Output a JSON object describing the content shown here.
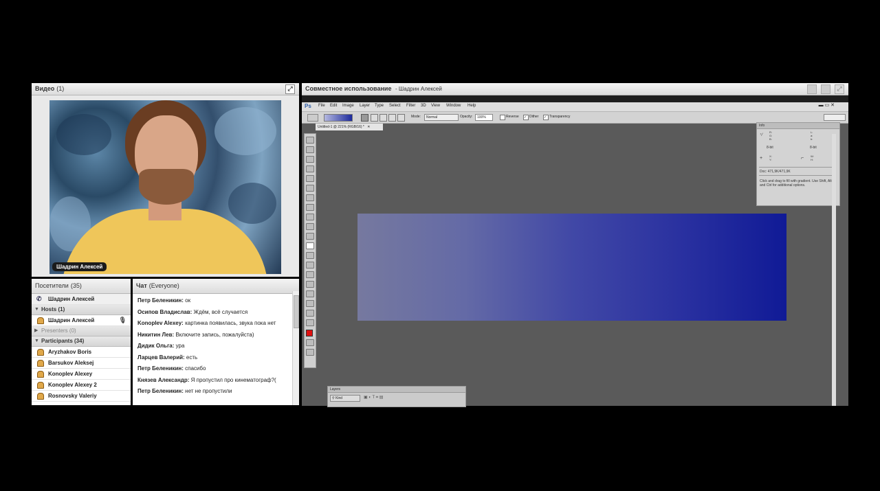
{
  "video": {
    "title": "Видео",
    "count": "(1)",
    "speaker": "Шадрин Алексей"
  },
  "attendees": {
    "title": "Посетители",
    "count": "(35)",
    "current_user": "Шадрин Алексей",
    "hosts_label": "Hosts (1)",
    "hosts": [
      "Шадрин Алексей"
    ],
    "presenters_label": "Presenters (0)",
    "participants_label": "Participants (34)",
    "participants": [
      "Aryzhakov Boris",
      "Barsukov Aleksej",
      "Konoplev Alexey",
      "Konoplev Alexey 2",
      "Rosnovsky Valeriy"
    ]
  },
  "chat": {
    "title": "Чат",
    "scope": "(Everyone)",
    "messages": [
      {
        "author": "Петр Беленикин:",
        "text": " ок"
      },
      {
        "author": "Осипов Владислав:",
        "text": " Ждём, всё случается"
      },
      {
        "author": "Konoplev Alexey:",
        "text": " картинка появилась, звука пока нет"
      },
      {
        "author": "Никитин Лев:",
        "text": " Включите запись, пожалуйста)"
      },
      {
        "author": "Дидик Ольга:",
        "text": " ура"
      },
      {
        "author": "Ларцев Валерий:",
        "text": " есть"
      },
      {
        "author": "Петр Беленикин:",
        "text": " спасибо"
      },
      {
        "author": "Князев Александр:",
        "text": " Я пропустил про кинематограф?("
      },
      {
        "author": "Петр Беленикин:",
        "text": " нет не пропустили"
      }
    ]
  },
  "share": {
    "title": "Совместное использование",
    "presenter": "- Шадрин Алексей"
  },
  "photoshop": {
    "logo": "Ps",
    "menus": [
      "File",
      "Edit",
      "Image",
      "Layer",
      "Type",
      "Select",
      "Filter",
      "3D",
      "View",
      "Window",
      "Help"
    ],
    "mode_label": "Mode:",
    "mode_value": "Normal",
    "opacity_label": "Opacity:",
    "opacity_value": "100%",
    "opt_reverse": "Reverse",
    "opt_dither": "Dither",
    "opt_transparency": "Transparency",
    "doc_tab": "Untitled-1 @ 221% (RGB/16) *",
    "info_title": "Info",
    "info_bit_left": "8-bit",
    "info_bit_right": "8-bit",
    "info_doc": "Doc: 471,9K/471,9K",
    "info_hint": "Click and drag to fill with gradient. Use Shift, Alt, and Ctrl for additional options.",
    "layers_title": "Layers",
    "layers_kind": "Kind",
    "gradient_start_color": "#76799f",
    "gradient_end_color": "#101a96"
  }
}
